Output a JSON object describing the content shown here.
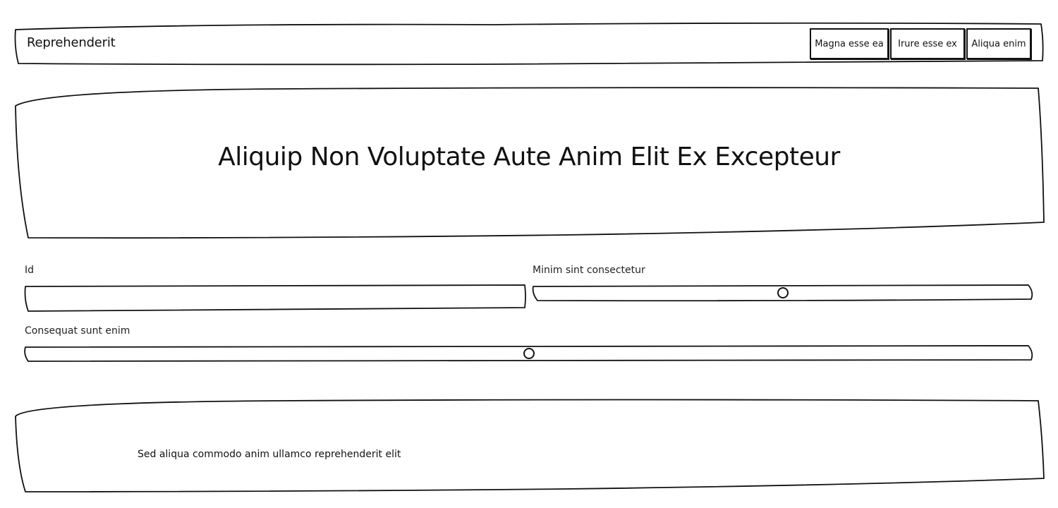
{
  "header": {
    "brand": "Reprehenderit",
    "nav": [
      {
        "label": "Magna esse ea"
      },
      {
        "label": "Irure esse ex"
      },
      {
        "label": "Aliqua enim"
      }
    ]
  },
  "hero": {
    "title": "Aliquip Non Voluptate Aute Anim Elit Ex Excepteur"
  },
  "form": {
    "id_field": {
      "label": "Id",
      "value": "",
      "placeholder": ""
    },
    "slider_one": {
      "label": "Minim sint consectetur",
      "value_fraction": 0.5
    },
    "slider_two": {
      "label": "Consequat sunt enim",
      "value_fraction": 0.5
    }
  },
  "footer": {
    "text": "Sed aliqua commodo anim ullamco reprehenderit elit"
  },
  "colors": {
    "ink": "#111111",
    "background": "#ffffff"
  }
}
